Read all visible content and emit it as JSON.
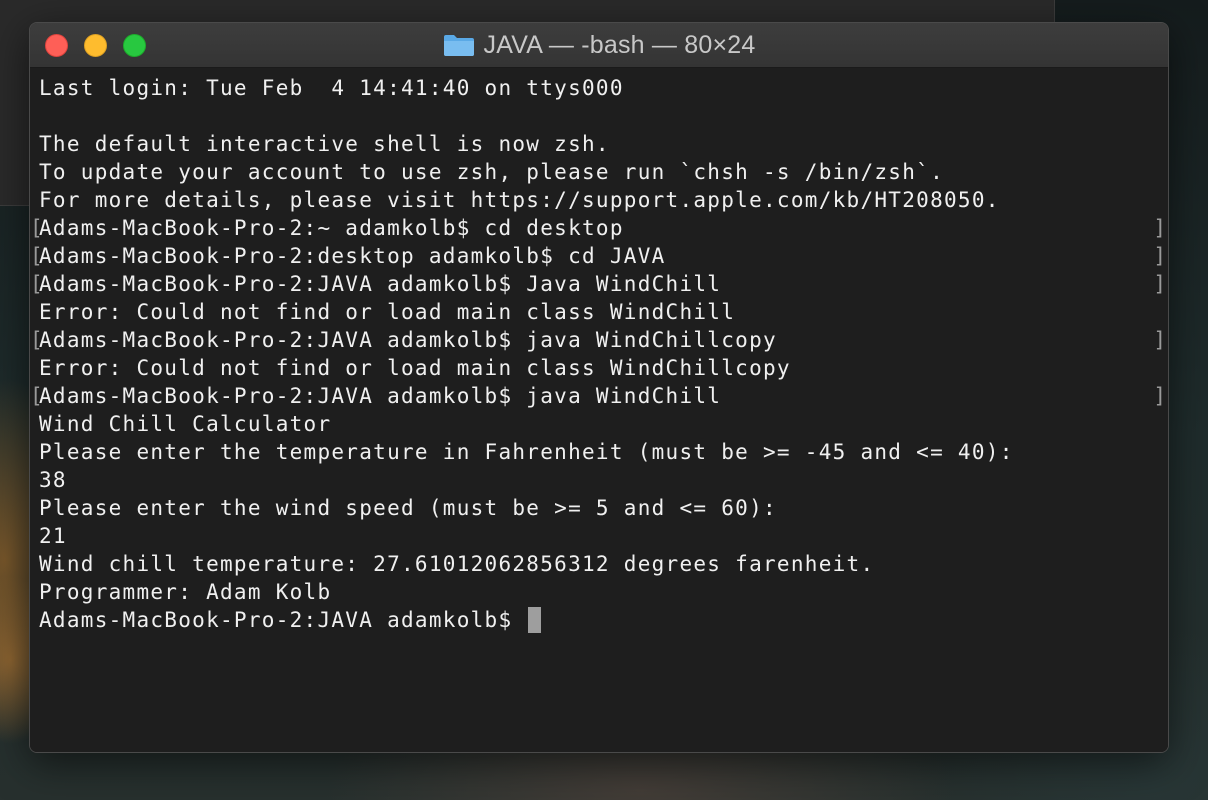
{
  "window": {
    "title": "JAVA — -bash — 80×24",
    "folder_icon": "folder-icon"
  },
  "terminal": {
    "lines": [
      {
        "text": "Last login: Tue Feb  4 14:41:40 on ttys000",
        "marked": false
      },
      {
        "text": "",
        "marked": false
      },
      {
        "text": "The default interactive shell is now zsh.",
        "marked": false
      },
      {
        "text": "To update your account to use zsh, please run `chsh -s /bin/zsh`.",
        "marked": false
      },
      {
        "text": "For more details, please visit https://support.apple.com/kb/HT208050.",
        "marked": false
      },
      {
        "text": "Adams-MacBook-Pro-2:~ adamkolb$ cd desktop",
        "marked": true
      },
      {
        "text": "Adams-MacBook-Pro-2:desktop adamkolb$ cd JAVA",
        "marked": true
      },
      {
        "text": "Adams-MacBook-Pro-2:JAVA adamkolb$ Java WindChill",
        "marked": true
      },
      {
        "text": "Error: Could not find or load main class WindChill",
        "marked": false
      },
      {
        "text": "Adams-MacBook-Pro-2:JAVA adamkolb$ java WindChillcopy",
        "marked": true
      },
      {
        "text": "Error: Could not find or load main class WindChillcopy",
        "marked": false
      },
      {
        "text": "Adams-MacBook-Pro-2:JAVA adamkolb$ java WindChill",
        "marked": true
      },
      {
        "text": "Wind Chill Calculator",
        "marked": false
      },
      {
        "text": "Please enter the temperature in Fahrenheit (must be >= -45 and <= 40):",
        "marked": false
      },
      {
        "text": "38",
        "marked": false
      },
      {
        "text": "Please enter the wind speed (must be >= 5 and <= 60):",
        "marked": false
      },
      {
        "text": "21",
        "marked": false
      },
      {
        "text": "Wind chill temperature: 27.61012062856312 degrees farenheit.",
        "marked": false
      },
      {
        "text": "Programmer: Adam Kolb",
        "marked": false
      }
    ],
    "prompt": "Adams-MacBook-Pro-2:JAVA adamkolb$ ",
    "mark_left": "[",
    "mark_right": "]"
  },
  "colors": {
    "close": "#fe5f57",
    "minimize": "#febc2e",
    "zoom": "#28c840",
    "terminal_bg": "#1e1e1e",
    "terminal_fg": "#f0f0f0",
    "cursor": "#9e9e9e"
  }
}
